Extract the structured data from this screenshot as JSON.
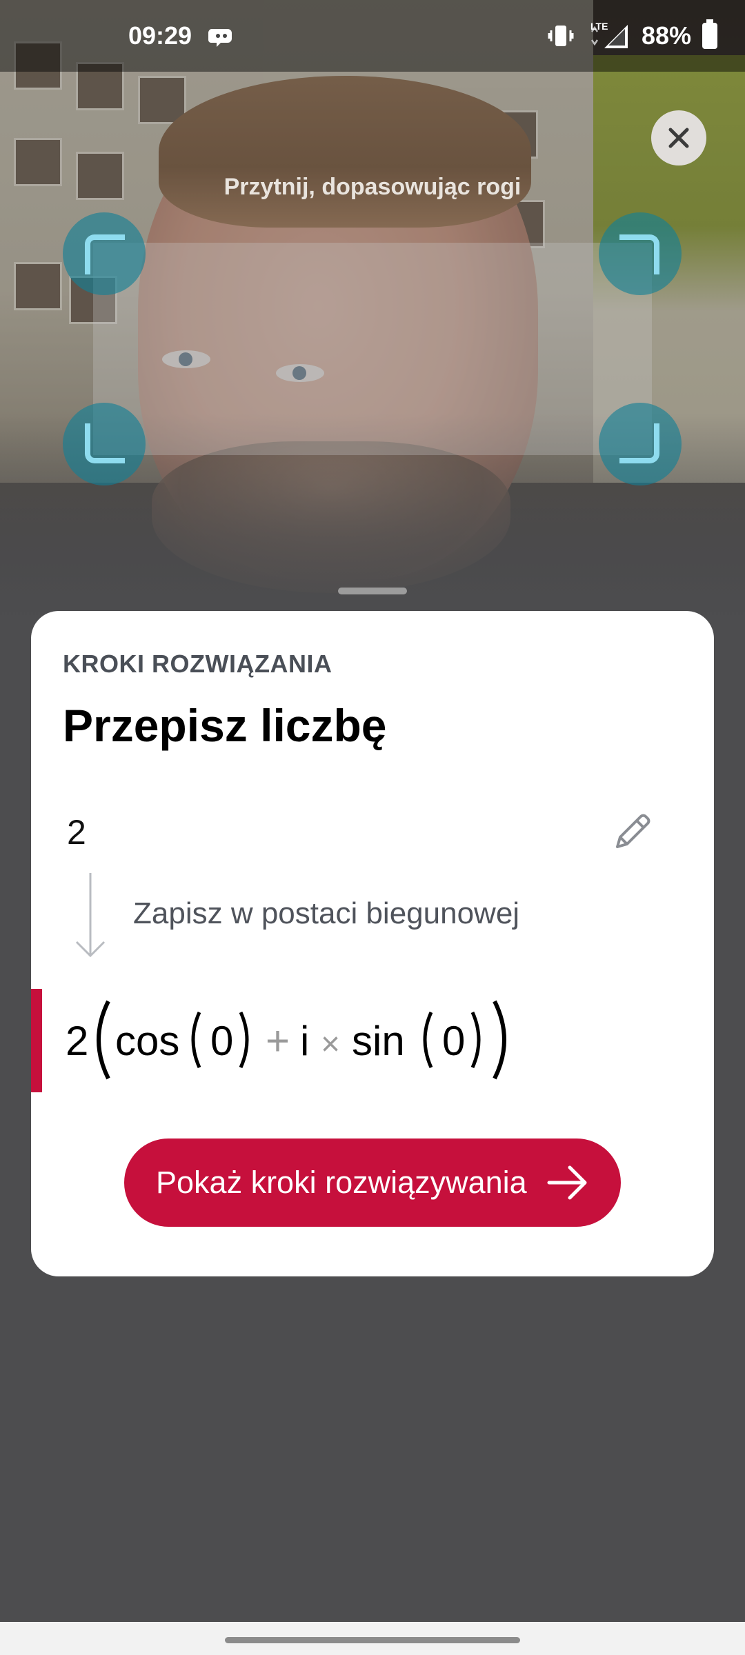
{
  "status_bar": {
    "time": "09:29",
    "network": "LTE",
    "battery": "88%"
  },
  "crop": {
    "hint": "Przytnij, dopasowując rogi",
    "close_icon": "close-icon"
  },
  "card": {
    "eyebrow": "KROKI ROZWIĄZANIA",
    "title": "Przepisz liczbę",
    "input_expression": "2",
    "step_description": "Zapisz w postaci biegunowej",
    "result": {
      "coefficient": "2",
      "cos": "cos",
      "cos_arg": "0",
      "plus": "+",
      "imag": "i",
      "times": "×",
      "sin": "sin",
      "sin_arg": "0"
    },
    "cta_label": "Pokaż kroki rozwiązywania"
  },
  "colors": {
    "accent": "#c6103c",
    "handle": "#128096",
    "card_bg": "#ffffff",
    "backdrop": "#4d4d4f"
  }
}
